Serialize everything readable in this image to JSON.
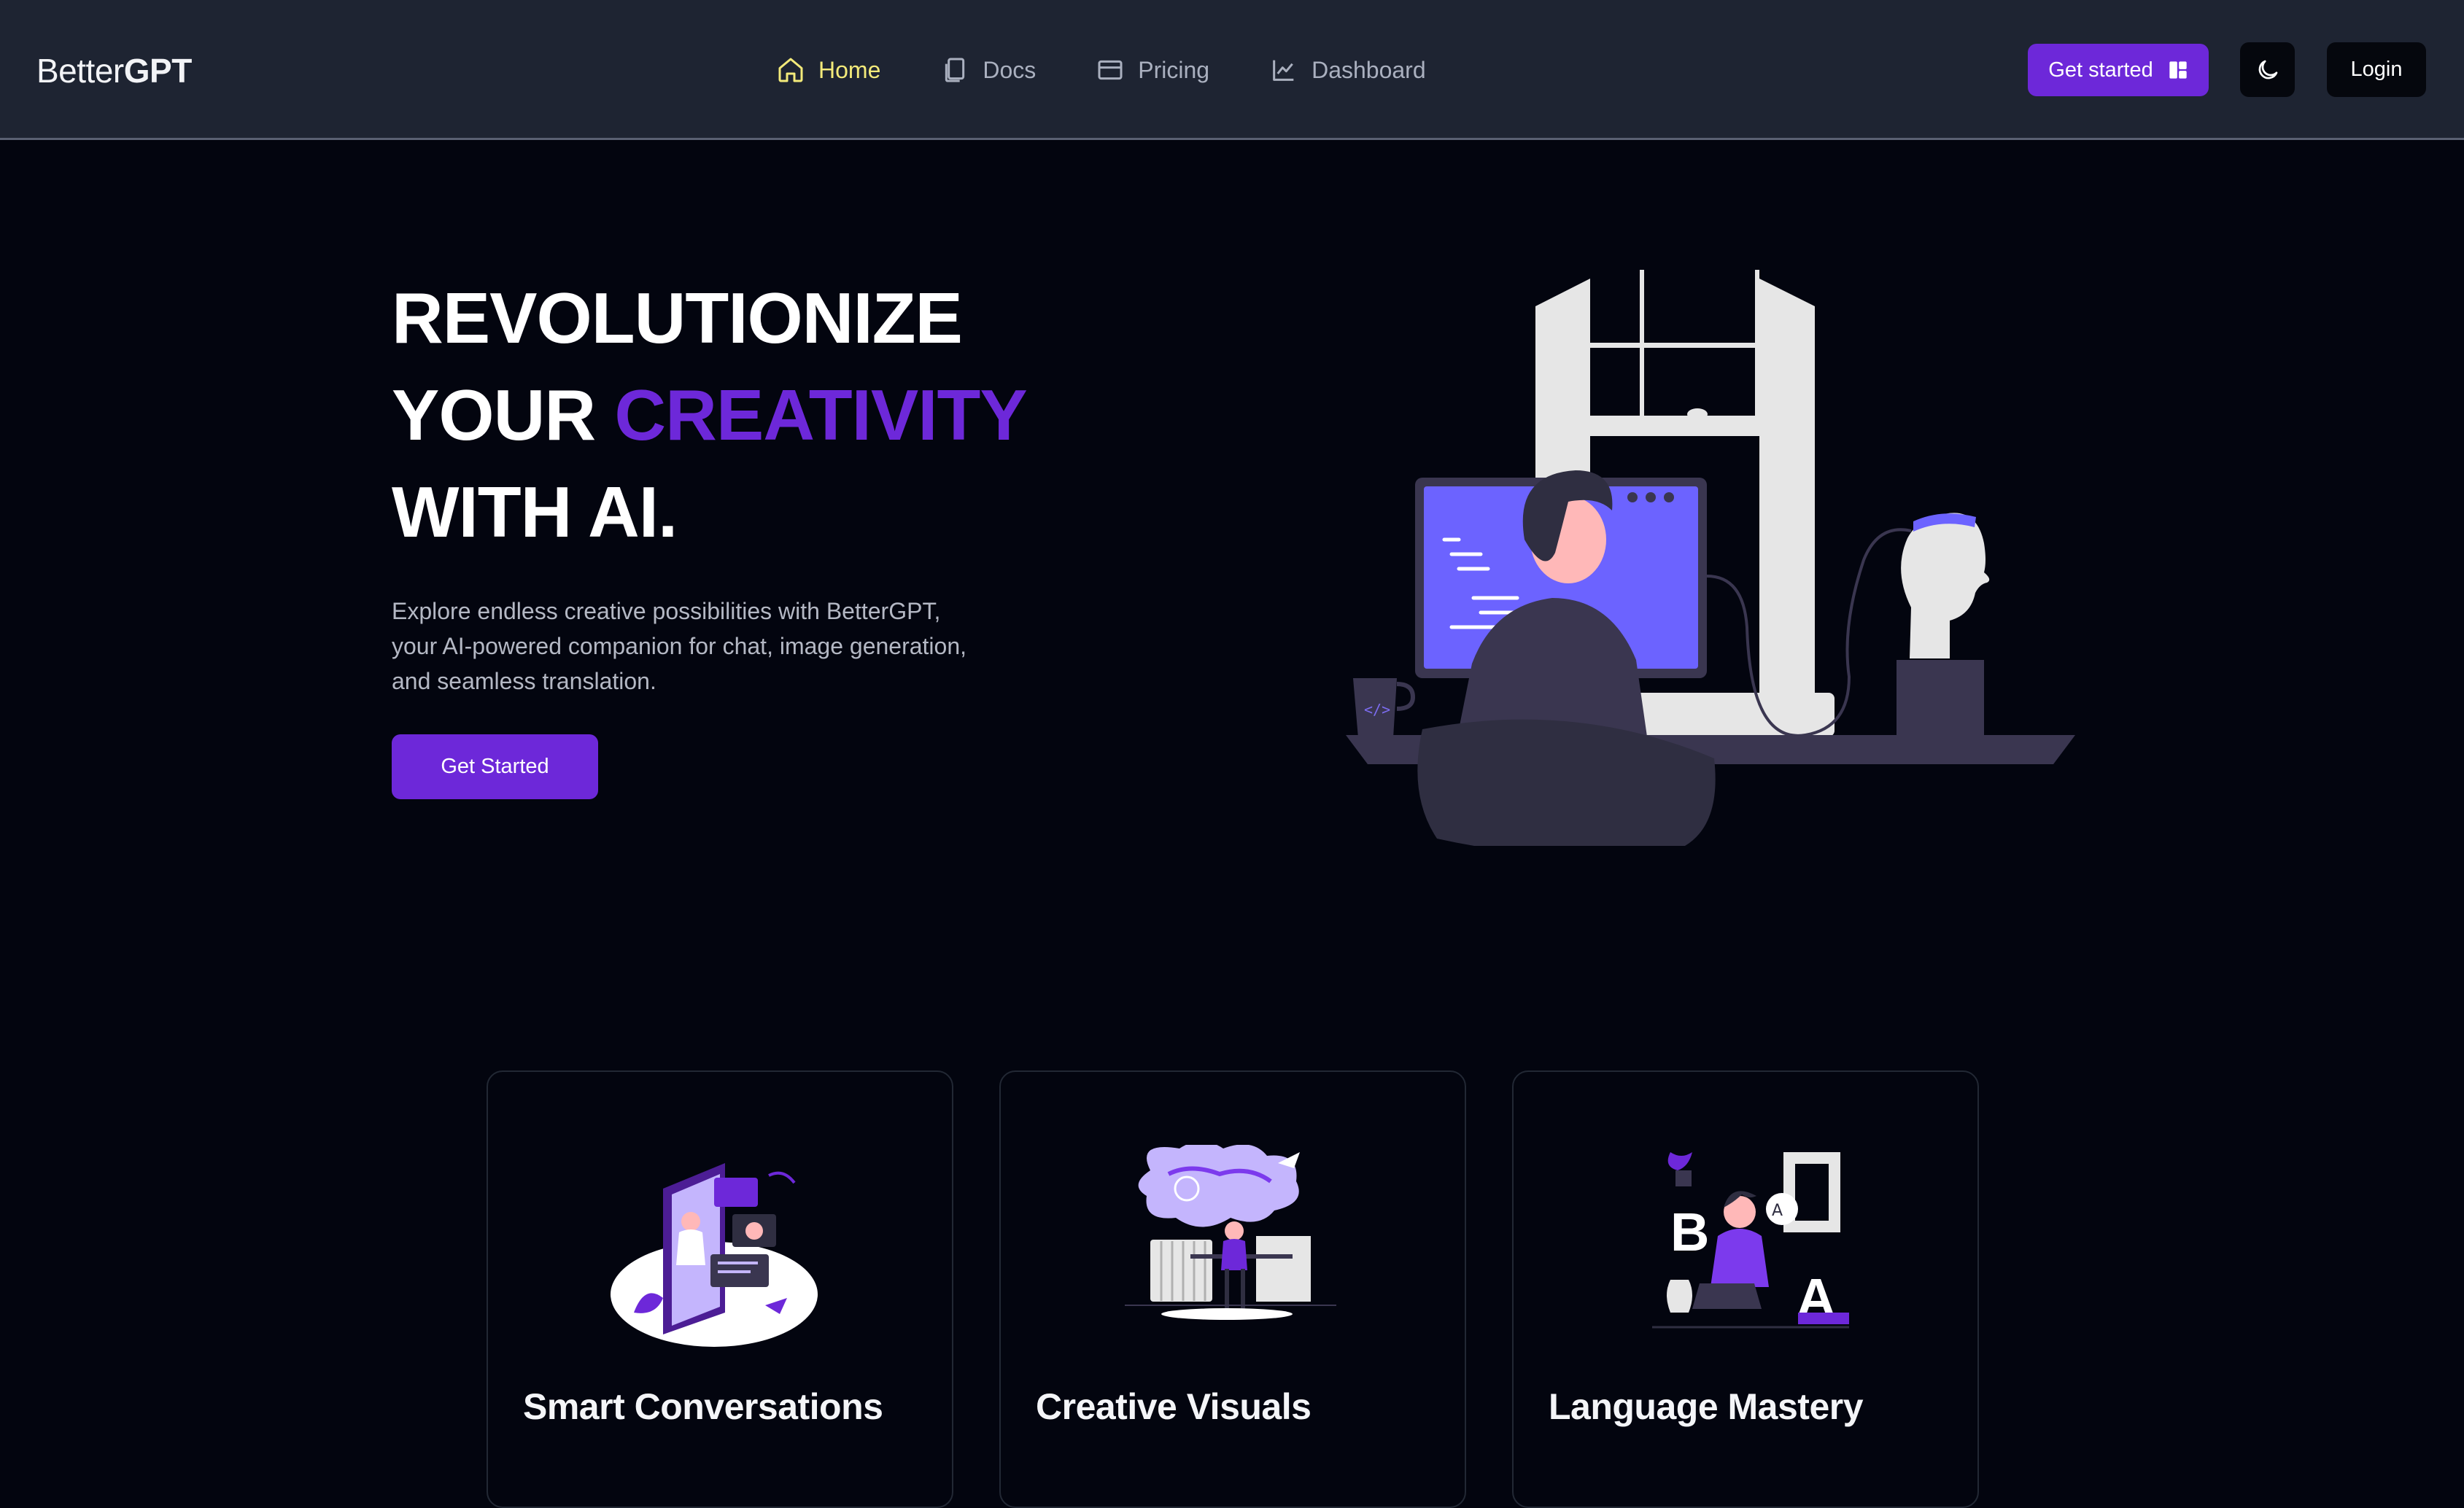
{
  "navbar": {
    "brand_light": "Better",
    "brand_bold": "GPT",
    "links": [
      {
        "label": "Home",
        "icon": "home-icon",
        "active": true
      },
      {
        "label": "Docs",
        "icon": "docs-icon",
        "active": false
      },
      {
        "label": "Pricing",
        "icon": "card-icon",
        "active": false
      },
      {
        "label": "Dashboard",
        "icon": "chart-icon",
        "active": false
      }
    ],
    "get_started": "Get started",
    "get_started_icon": "layout-icon",
    "theme_icon": "moon-icon",
    "login": "Login"
  },
  "hero": {
    "line1": "REVOLUTIONIZE",
    "line2_plain": "YOUR ",
    "line2_accent": "CREATIVITY",
    "line3": "WITH AI.",
    "description": "Explore endless creative possibilities with BetterGPT, your AI-powered companion for chat, image generation, and seamless translation.",
    "cta": "Get Started"
  },
  "features": [
    {
      "title": "Smart Conversations",
      "illustration": "phone-video-chat-illustration"
    },
    {
      "title": "Creative Visuals",
      "illustration": "dreaming-at-desk-illustration"
    },
    {
      "title": "Language Mastery",
      "illustration": "letters-and-laptop-illustration"
    }
  ],
  "colors": {
    "accent": "#6d28d9",
    "active_nav": "#f3ea7a",
    "navbar_bg": "#1e2432",
    "page_bg": "#03050f"
  }
}
